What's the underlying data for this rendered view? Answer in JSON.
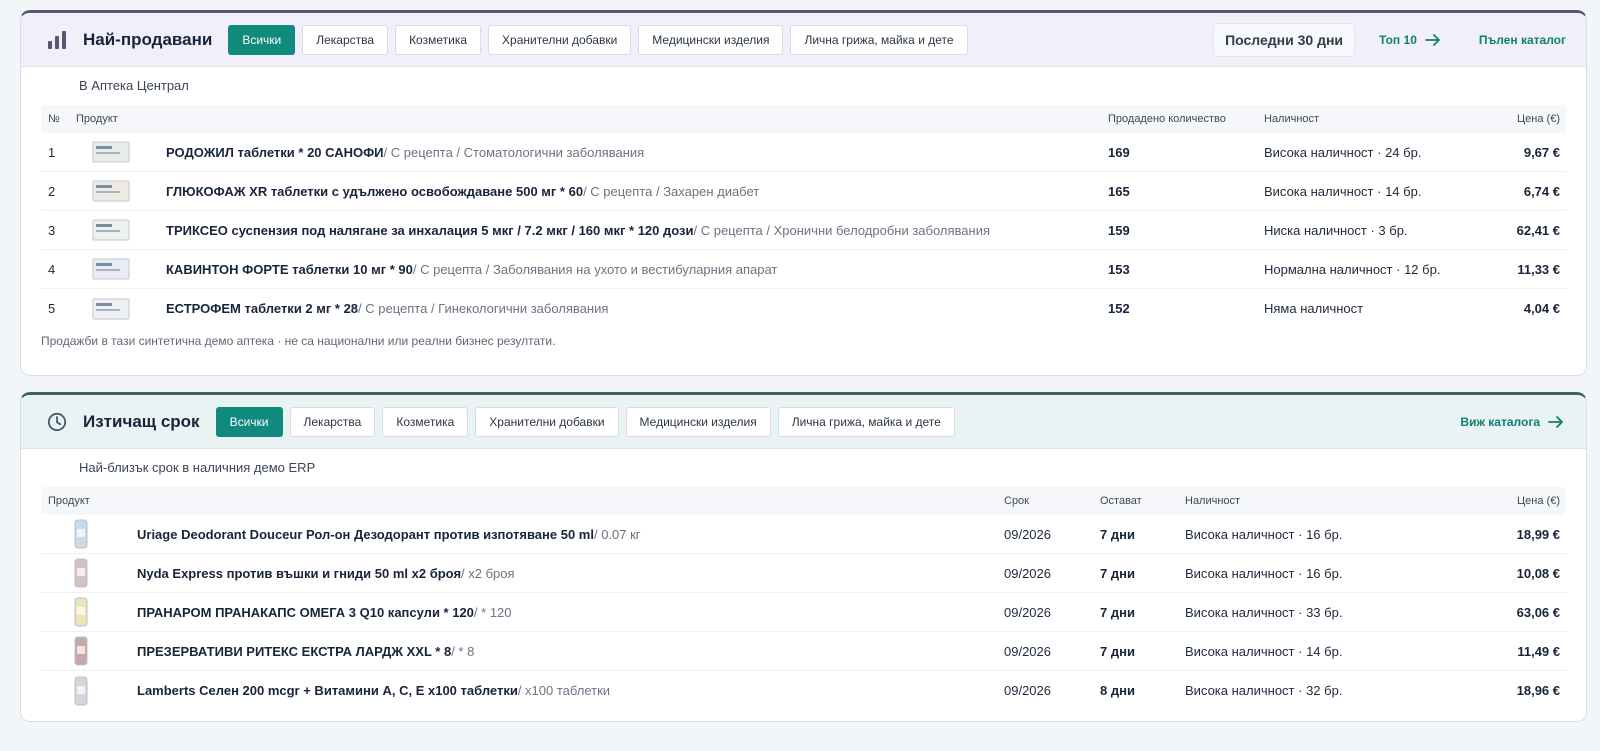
{
  "colors": {
    "accent": "#0f8a7c",
    "title": "#18243a"
  },
  "bestsellers": {
    "icon": "bar-chart-icon",
    "title": "Най-продавани",
    "tabs": [
      {
        "label": "Всички",
        "active": true
      },
      {
        "label": "Лекарства"
      },
      {
        "label": "Козметика"
      },
      {
        "label": "Хранителни добавки"
      },
      {
        "label": "Медицински изделия"
      },
      {
        "label": "Лична грижа, майка и дете"
      }
    ],
    "period": "Последни 30 дни",
    "top_link": "Топ 10",
    "catalog_link": "Пълен каталог",
    "subtitle": "В Аптека Централ",
    "columns": {
      "no": "№",
      "product": "Продукт",
      "sold": "Продадено количество",
      "stock": "Наличност",
      "price": "Цена (€)"
    },
    "rows": [
      {
        "no": "1",
        "name": "РОДОЖИЛ таблетки * 20 САНОФИ",
        "meta": " / С рецепта / Стоматологични заболявания",
        "sold": "169",
        "stock": "Висока наличност · 24 бр.",
        "price": "9,67 €"
      },
      {
        "no": "2",
        "name": "ГЛЮКОФАЖ XR таблетки с удължено освобождаване 500 мг * 60",
        "meta": " / С рецепта / Захарен диабет",
        "sold": "165",
        "stock": "Висока наличност · 14 бр.",
        "price": "6,74 €"
      },
      {
        "no": "3",
        "name": "ТРИКСЕО суспензия под налягане за инхалация 5 мкг / 7.2 мкг / 160 мкг * 120 дози",
        "meta": " / С рецепта / Хронични белодробни заболявания",
        "sold": "159",
        "stock": "Ниска наличност · 3 бр.",
        "price": "62,41 €"
      },
      {
        "no": "4",
        "name": "КАВИНТОН ФОРТЕ таблетки 10 мг * 90",
        "meta": " / С рецепта / Заболявания на ухото и вестибуларния апарат",
        "sold": "153",
        "stock": "Нормална наличност · 12 бр.",
        "price": "11,33 €"
      },
      {
        "no": "5",
        "name": "ЕСТРОФЕМ таблетки 2 мг * 28",
        "meta": " / С рецепта / Гинекологични заболявания",
        "sold": "152",
        "stock": "Няма наличност",
        "price": "4,04 €"
      }
    ],
    "footnote": "Продажби в тази синтетична демо аптека · не са национални или реални бизнес резултати."
  },
  "expiring": {
    "icon": "clock-icon",
    "title": "Изтичащ срок",
    "tabs": [
      {
        "label": "Всички",
        "active": true
      },
      {
        "label": "Лекарства"
      },
      {
        "label": "Козметика"
      },
      {
        "label": "Хранителни добавки"
      },
      {
        "label": "Медицински изделия"
      },
      {
        "label": "Лична грижа, майка и дете"
      }
    ],
    "catalog_link": "Виж каталога",
    "subtitle": "Най-близък срок в наличния демо ERP",
    "columns": {
      "product": "Продукт",
      "expiry": "Срок",
      "left": "Остават",
      "stock": "Наличност",
      "price": "Цена (€)"
    },
    "rows": [
      {
        "name": "Uriage Deodorant Douceur Рол-он Дезодорант против изпотяване 50 ml",
        "meta": " / 0.07 кг",
        "expiry": "09/2026",
        "left": "7 дни",
        "stock": "Висока наличност · 16 бр.",
        "price": "18,99 €"
      },
      {
        "name": "Nyda Express против въшки и гниди 50 ml x2 броя",
        "meta": " / x2 броя",
        "expiry": "09/2026",
        "left": "7 дни",
        "stock": "Висока наличност · 16 бр.",
        "price": "10,08 €"
      },
      {
        "name": "ПРАНАРОМ ПРАНАКАПС ОМЕГА 3 Q10 капсули * 120",
        "meta": " / * 120",
        "expiry": "09/2026",
        "left": "7 дни",
        "stock": "Висока наличност · 33 бр.",
        "price": "63,06 €"
      },
      {
        "name": "ПРЕЗЕРВАТИВИ РИТЕКС ЕКСТРА ЛАРДЖ XXL * 8",
        "meta": " / * 8",
        "expiry": "09/2026",
        "left": "7 дни",
        "stock": "Висока наличност · 14 бр.",
        "price": "11,49 €"
      },
      {
        "name": "Lamberts Селен 200 mcgr + Витамини А, С, Е x100 таблетки",
        "meta": " / x100 таблетки",
        "expiry": "09/2026",
        "left": "8 дни",
        "stock": "Висока наличност · 32 бр.",
        "price": "18,96 €"
      }
    ]
  }
}
